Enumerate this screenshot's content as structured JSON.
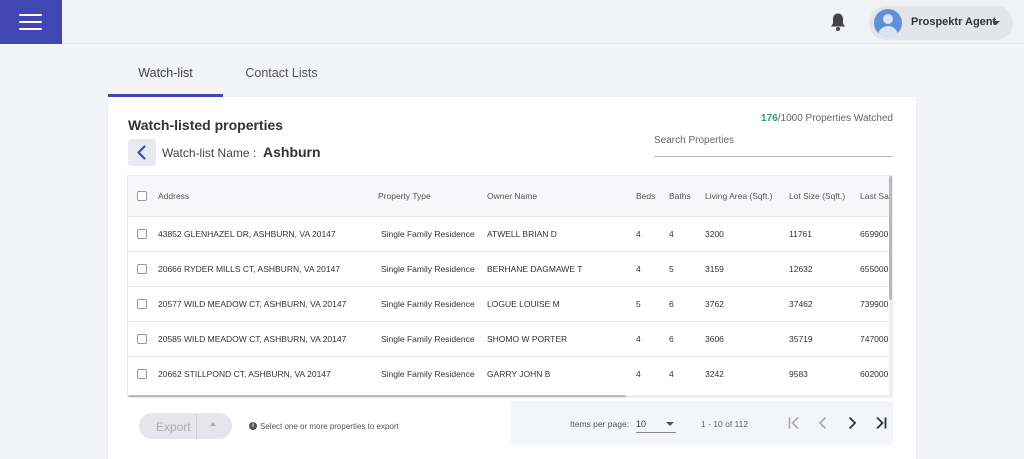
{
  "header": {
    "user_name": "Prospektr Agent"
  },
  "tabs": [
    {
      "label": "Watch-list",
      "active": true
    },
    {
      "label": "Contact Lists",
      "active": false
    }
  ],
  "card": {
    "title": "Watch-listed properties",
    "watchlist_label": "Watch-list Name :",
    "watchlist_name": "Ashburn",
    "watched_count": "176",
    "watched_total": "/1000",
    "watched_suffix": " Properties Watched",
    "search_placeholder": "Search Properties"
  },
  "table": {
    "columns": [
      "Address",
      "Property Type",
      "Owner Name",
      "Beds",
      "Baths",
      "Living Area (Sqft.)",
      "Lot Size (Sqft.)",
      "Last Sale"
    ],
    "rows": [
      {
        "address": "43852 GLENHAZEL DR, ASHBURN, VA 20147",
        "type": "Single Family Residence",
        "owner": "ATWELL BRIAN D",
        "beds": "4",
        "baths": "4",
        "area": "3200",
        "lot": "11761",
        "last": "659900"
      },
      {
        "address": "20666 RYDER MILLS CT, ASHBURN, VA 20147",
        "type": "Single Family Residence",
        "owner": "BERHANE DAGMAWE T",
        "beds": "4",
        "baths": "5",
        "area": "3159",
        "lot": "12632",
        "last": "655000"
      },
      {
        "address": "20577 WILD MEADOW CT, ASHBURN, VA 20147",
        "type": "Single Family Residence",
        "owner": "LOGUE LOUISE M",
        "beds": "5",
        "baths": "6",
        "area": "3762",
        "lot": "37462",
        "last": "739900"
      },
      {
        "address": "20585 WILD MEADOW CT, ASHBURN, VA 20147",
        "type": "Single Family Residence",
        "owner": "SHOMO W PORTER",
        "beds": "4",
        "baths": "6",
        "area": "3606",
        "lot": "35719",
        "last": "747000"
      },
      {
        "address": "20662 STILLPOND CT, ASHBURN, VA 20147",
        "type": "Single Family Residence",
        "owner": "GARRY JOHN B",
        "beds": "4",
        "baths": "4",
        "area": "3242",
        "lot": "9583",
        "last": "602000"
      }
    ]
  },
  "footer": {
    "export_label": "Export",
    "export_hint": "Select one or more properties to export",
    "items_per_page_label": "Items per page:",
    "items_per_page_value": "10",
    "range_text": "1 - 10 of 112"
  },
  "icons": {
    "menu": "hamburger-icon",
    "bell": "bell-icon",
    "back": "chevron-left-icon",
    "first": "first-page-icon",
    "prev": "chevron-left-icon",
    "next": "chevron-right-icon",
    "last": "last-page-icon"
  },
  "colors": {
    "brand": "#4046b2",
    "count": "#2aa27e"
  }
}
